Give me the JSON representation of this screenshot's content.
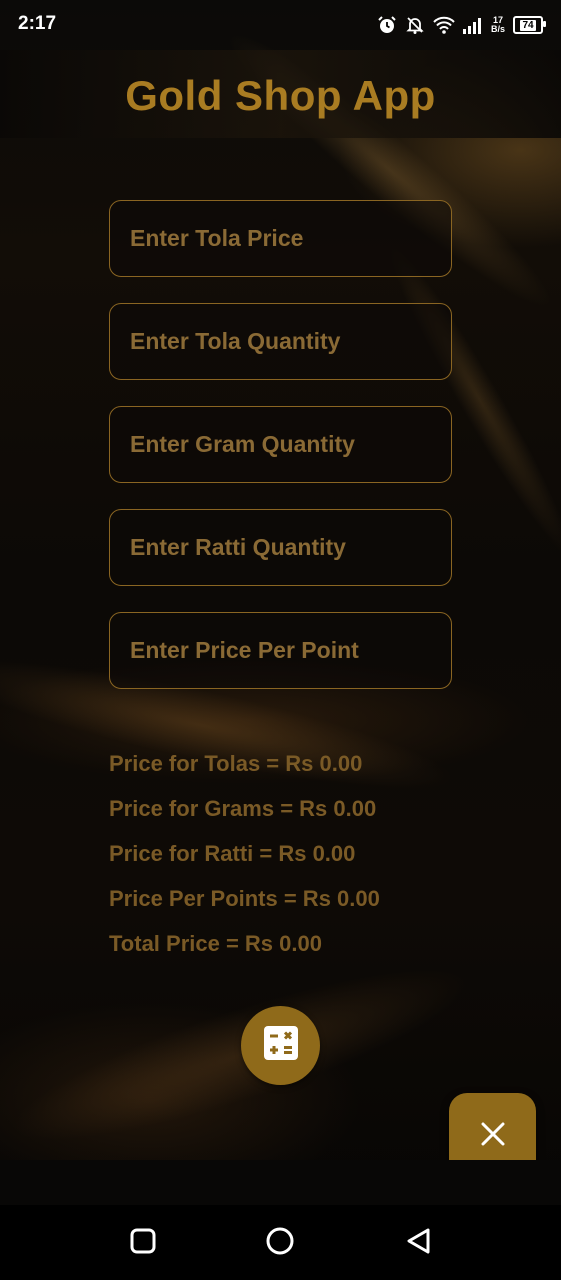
{
  "status_bar": {
    "time": "2:17",
    "network_speed_value": "17",
    "network_speed_unit": "B/s",
    "battery_level": "74",
    "icons": [
      "alarm-icon",
      "notifications-off-icon",
      "wifi-icon",
      "signal-icon",
      "battery-icon"
    ]
  },
  "app": {
    "title": "Gold Shop App"
  },
  "fields": {
    "tola_price": {
      "placeholder": "Enter Tola Price",
      "value": ""
    },
    "tola_quantity": {
      "placeholder": "Enter Tola Quantity",
      "value": ""
    },
    "gram_quantity": {
      "placeholder": "Enter Gram Quantity",
      "value": ""
    },
    "ratti_quantity": {
      "placeholder": "Enter Ratti Quantity",
      "value": ""
    },
    "price_per_point": {
      "placeholder": "Enter Price Per Point",
      "value": ""
    }
  },
  "results": {
    "tolas": "Price for Tolas = Rs 0.00",
    "grams": "Price for Grams = Rs 0.00",
    "ratti": "Price for Ratti = Rs 0.00",
    "points": "Price Per Points = Rs 0.00",
    "total": "Total Price = Rs 0.00"
  },
  "buttons": {
    "calculate_icon": "calculator-icon",
    "close_icon": "close-icon"
  },
  "navigation": [
    "recents-square-icon",
    "home-circle-icon",
    "back-triangle-icon"
  ],
  "colors": {
    "accent_gold": "#a97c22",
    "button_gold": "#8f6a1a",
    "field_border": "#8a6522",
    "result_text": "#7a5a26"
  }
}
